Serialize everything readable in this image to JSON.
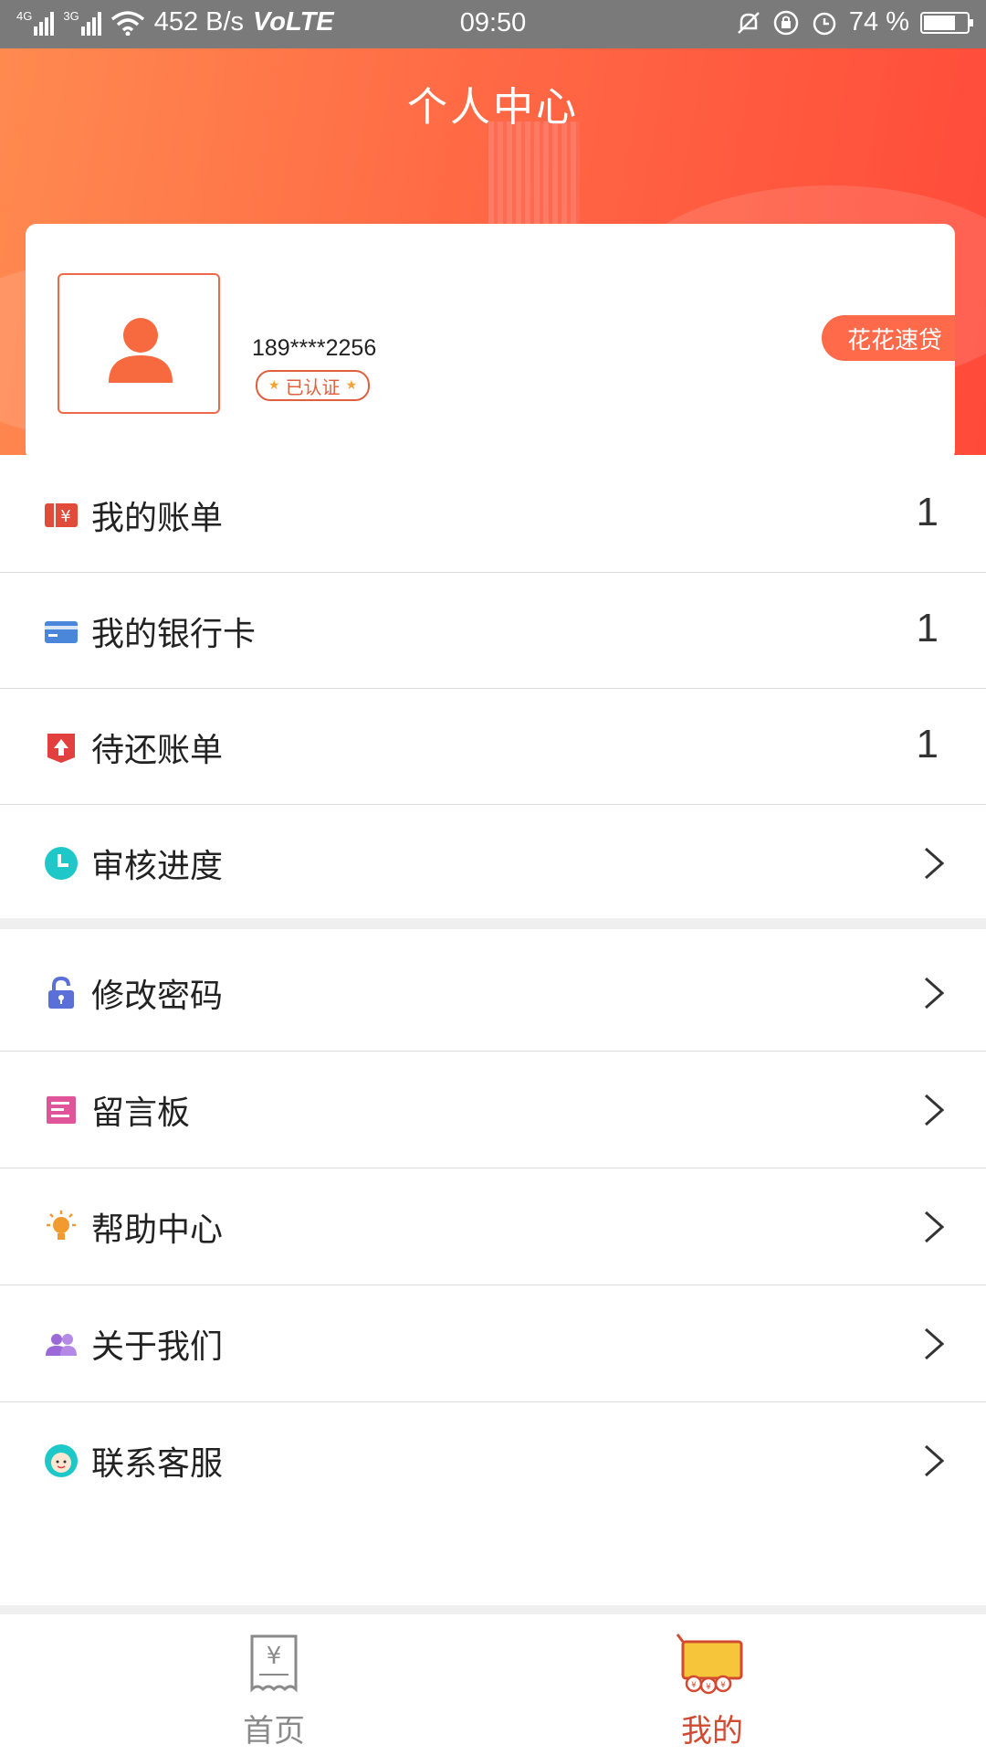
{
  "status_bar": {
    "network_left": "4G",
    "network_right": "3G",
    "speed": "452 B/s",
    "volte": "VoLTE",
    "time": "09:50",
    "battery_percent": "74 %",
    "battery_level": 0.74
  },
  "header": {
    "title": "个人中心"
  },
  "profile": {
    "phone": "189****2256",
    "verified_label": "已认证",
    "brand_tag": "花花速贷"
  },
  "menu_group_1": [
    {
      "label": "我的账单",
      "count": "1",
      "icon": "bill-icon"
    },
    {
      "label": "我的银行卡",
      "count": "1",
      "icon": "bank-card-icon"
    },
    {
      "label": "待还账单",
      "count": "1",
      "icon": "repay-icon"
    },
    {
      "label": "审核进度",
      "icon": "clock-icon"
    }
  ],
  "menu_group_2": [
    {
      "label": "修改密码",
      "icon": "lock-icon"
    },
    {
      "label": "留言板",
      "icon": "message-board-icon"
    },
    {
      "label": "帮助中心",
      "icon": "lightbulb-icon"
    },
    {
      "label": "关于我们",
      "icon": "people-icon"
    },
    {
      "label": "联系客服",
      "icon": "customer-service-icon"
    }
  ],
  "bottom_nav": {
    "home_label": "首页",
    "mine_label": "我的",
    "active_color": "#d24a30",
    "inactive_color": "#8a8a8a"
  },
  "colors": {
    "accent": "#ff6a4a",
    "header_start": "#ff8a50",
    "header_end": "#ff4a3a"
  }
}
